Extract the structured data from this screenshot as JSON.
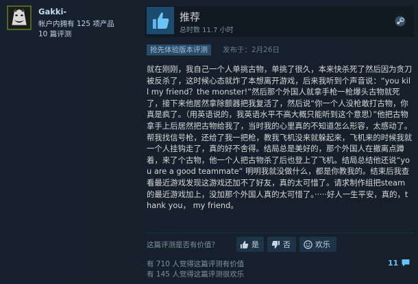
{
  "author": {
    "username": "Gakki-",
    "products_owned": "帐户内拥有 125 项产品",
    "review_count": "10 篇评测",
    "avatar_icon": "joker-avatar-icon"
  },
  "rating": {
    "title": "推荐",
    "playtime": "总时数 11.7 小时",
    "thumb_icon": "thumbs-up-icon",
    "platform_icon": "steam-logo-icon"
  },
  "meta": {
    "early_access_label": "抢先体验版本评测",
    "posted": "发布于：2月26日"
  },
  "review_text": "就在刚刚，我自己一个人单挑古物，单挑了很久，本来快杀死了然后因为贪刀被反杀了，这时候心态就炸了本想离开游戏，后来我听到个声音说：“you kill my friend？the monster!”然后那个外国人就拿手枪一枪爆头古物就死了，接下来他居然拿除颤器把我复活了，然后说“你一个人没枪敢打古物，你真是疯了。（用英语说的，我英语水平不高大概只能听到这个意思）”他把古物拿手上后居然把古物给我了，当时我的心里真的不知道怎么形容，太感动了。 帮我找信号枪，还给了我一把枪，教我飞机没来就躲起来，飞机来的时候我就一个人挂钩走了，真的好不舍得。结局总是美好的，那个外国人在撤离点蹲着，来了个古物，他一个人把古物杀了后也登上了飞机。结局总结他还说“you are a good teammate“ 明明我就没做什么，都是你教我的。结束后我查看最近游戏发现这游戏还加不了好友，真的太可惜了。请求制作组把steam的最近游戏加上，没加那个外国人真的太可惜了。·····好人一生平安，真的，thank you， my friend。",
  "feedback": {
    "question": "这篇评测是否有价值？",
    "yes_label": "是",
    "no_label": "否",
    "funny_label": "欢乐",
    "helpful_count": "有 710 人觉得这篇评测有价值",
    "funny_count": "有 145 人觉得这篇评测很欢乐",
    "comment_count": "11"
  },
  "colors": {
    "accent": "#67c1f5",
    "thumb_bg": "#1c4b6e",
    "early_access_bg": "#2b4c68"
  }
}
